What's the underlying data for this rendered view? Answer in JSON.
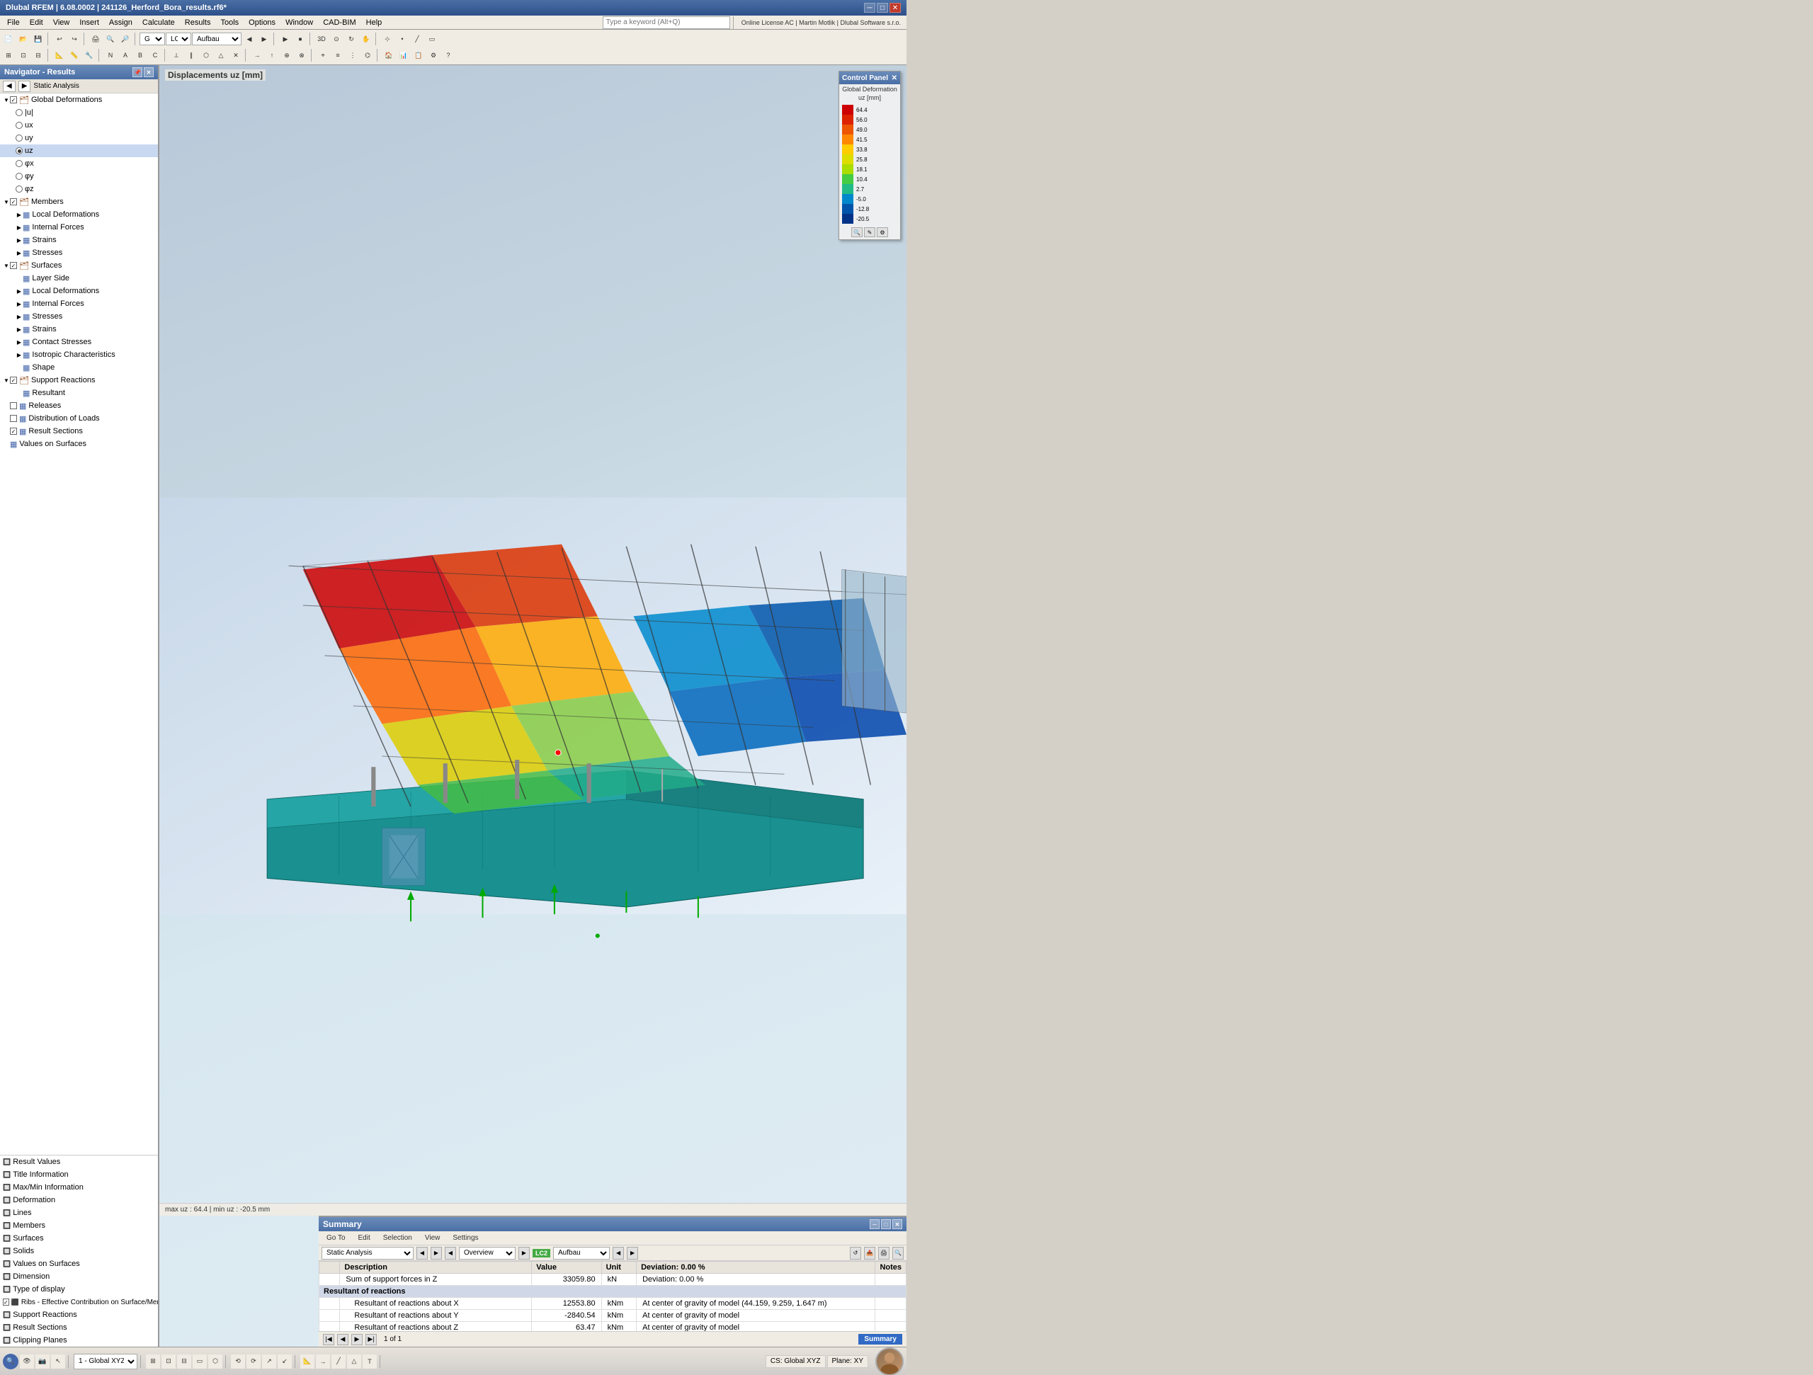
{
  "titleBar": {
    "title": "Dlubal RFEM | 6.08.0002 | 241126_Herford_Bora_results.rf6*",
    "minimize": "─",
    "maximize": "□",
    "close": "✕"
  },
  "menuBar": {
    "items": [
      "File",
      "Edit",
      "View",
      "Insert",
      "Assign",
      "Calculate",
      "Results",
      "Tools",
      "Options",
      "Window",
      "CAD-BIM",
      "Help"
    ]
  },
  "toolbar": {
    "keywordPlaceholder": "Type a keyword (Alt+Q)",
    "licenseInfo": "Online License AC | Martin Motlik | Dlubal Software s.r.o.",
    "lcLabel": "LC2",
    "loadCase": "Aufbau"
  },
  "navigator": {
    "title": "Navigator - Results",
    "dropdown": "Static Analysis",
    "tree": [
      {
        "id": "global-def",
        "label": "Global Deformations",
        "level": 0,
        "type": "checkbox",
        "checked": true,
        "expanded": true,
        "icon": "folder"
      },
      {
        "id": "u",
        "label": "|u|",
        "level": 1,
        "type": "radio",
        "checked": false
      },
      {
        "id": "ux",
        "label": "ux",
        "level": 1,
        "type": "radio",
        "checked": false
      },
      {
        "id": "uy",
        "label": "uy",
        "level": 1,
        "type": "radio",
        "checked": false
      },
      {
        "id": "uz",
        "label": "uz",
        "level": 1,
        "type": "radio",
        "checked": true
      },
      {
        "id": "px",
        "label": "φx",
        "level": 1,
        "type": "radio",
        "checked": false
      },
      {
        "id": "py",
        "label": "φy",
        "level": 1,
        "type": "radio",
        "checked": false
      },
      {
        "id": "pz",
        "label": "φz",
        "level": 1,
        "type": "radio",
        "checked": false
      },
      {
        "id": "members",
        "label": "Members",
        "level": 0,
        "type": "checkbox",
        "checked": true,
        "expanded": true,
        "icon": "folder"
      },
      {
        "id": "local-def",
        "label": "Local Deformations",
        "level": 1,
        "type": "item",
        "expanded": false
      },
      {
        "id": "internal-forces",
        "label": "Internal Forces",
        "level": 1,
        "type": "item",
        "expanded": false
      },
      {
        "id": "strains-m",
        "label": "Strains",
        "level": 1,
        "type": "item",
        "expanded": false
      },
      {
        "id": "stresses-m",
        "label": "Stresses",
        "level": 1,
        "type": "item",
        "expanded": false
      },
      {
        "id": "surfaces",
        "label": "Surfaces",
        "level": 0,
        "type": "checkbox",
        "checked": true,
        "expanded": true,
        "icon": "folder"
      },
      {
        "id": "layer-side",
        "label": "Layer Side",
        "level": 1,
        "type": "item"
      },
      {
        "id": "local-def-s",
        "label": "Local Deformations",
        "level": 1,
        "type": "item"
      },
      {
        "id": "internal-forces-s",
        "label": "Internal Forces",
        "level": 1,
        "type": "item"
      },
      {
        "id": "stresses-s",
        "label": "Stresses",
        "level": 1,
        "type": "item"
      },
      {
        "id": "strains-s",
        "label": "Strains",
        "level": 1,
        "type": "item"
      },
      {
        "id": "contact-stresses",
        "label": "Contact Stresses",
        "level": 1,
        "type": "item"
      },
      {
        "id": "iso-char",
        "label": "Isotropic Characteristics",
        "level": 1,
        "type": "item"
      },
      {
        "id": "shape",
        "label": "Shape",
        "level": 1,
        "type": "item"
      },
      {
        "id": "support-reactions",
        "label": "Support Reactions",
        "level": 0,
        "type": "checkbox",
        "checked": true,
        "expanded": true,
        "icon": "folder"
      },
      {
        "id": "resultant",
        "label": "Resultant",
        "level": 1,
        "type": "item"
      },
      {
        "id": "releases",
        "label": "Releases",
        "level": 0,
        "type": "item"
      },
      {
        "id": "dist-loads",
        "label": "Distribution of Loads",
        "level": 0,
        "type": "item"
      },
      {
        "id": "result-sections",
        "label": "Result Sections",
        "level": 0,
        "type": "checkbox",
        "checked": true
      },
      {
        "id": "values-surfaces",
        "label": "Values on Surfaces",
        "level": 0,
        "type": "item"
      }
    ]
  },
  "navigatorBottom": {
    "items": [
      {
        "id": "result-values",
        "label": "Result Values"
      },
      {
        "id": "title-info",
        "label": "Title Information"
      },
      {
        "id": "max-min-info",
        "label": "Max/Min Information"
      },
      {
        "id": "deformation",
        "label": "Deformation"
      },
      {
        "id": "lines",
        "label": "Lines"
      },
      {
        "id": "members-b",
        "label": "Members"
      },
      {
        "id": "surfaces-b",
        "label": "Surfaces"
      },
      {
        "id": "solids",
        "label": "Solids"
      },
      {
        "id": "values-surfaces-b",
        "label": "Values on Surfaces"
      },
      {
        "id": "dimension",
        "label": "Dimension"
      },
      {
        "id": "type-display",
        "label": "Type of display"
      },
      {
        "id": "ribs",
        "label": "Ribs - Effective Contribution on Surface/Member"
      },
      {
        "id": "support-reactions-b",
        "label": "Support Reactions"
      },
      {
        "id": "result-sections-b",
        "label": "Result Sections"
      },
      {
        "id": "clipping-planes",
        "label": "Clipping Planes"
      }
    ]
  },
  "viewport": {
    "label": "Displacements uz [mm]",
    "infoText": "max uz : 64.4 | min uz : -20.5 mm"
  },
  "colorPanel": {
    "title": "Control Panel",
    "subtitle": "Global Deformation\nuz [mm]",
    "values": [
      "64.4",
      "56.0",
      "49.0",
      "41.5",
      "33.8",
      "25.8",
      "18.1",
      "10.4",
      "2.7",
      "-5.0",
      "-12.8",
      "-20.5"
    ],
    "colors": [
      "#cc0000",
      "#dd2200",
      "#ee4400",
      "#ff6600",
      "#ffaa00",
      "#ffdd00",
      "#aadd00",
      "#55cc44",
      "#00aa88",
      "#0077cc",
      "#0044aa",
      "#002288"
    ]
  },
  "summary": {
    "title": "Summary",
    "toolbar": [
      "Go To",
      "Edit",
      "Selection",
      "View",
      "Settings"
    ],
    "analysisType": "Static Analysis",
    "overviewLabel": "Overview",
    "lcBadge": "LC2",
    "lcName": "Aufbau",
    "tableHeaders": [
      "",
      "Description",
      "Value",
      "Unit",
      "Deviation: 0.00 %",
      "Notes"
    ],
    "rows": [
      {
        "type": "data",
        "desc": "Sum of support forces in Z",
        "value": "33059.80",
        "unit": "kN",
        "deviation": "Deviation: 0.00 %",
        "notes": ""
      },
      {
        "type": "group",
        "desc": "Resultant of reactions",
        "value": "",
        "unit": "",
        "deviation": "",
        "notes": ""
      },
      {
        "type": "data",
        "desc": "Resultant of reactions about X",
        "value": "12553.80",
        "unit": "kNm",
        "deviation": "At center of gravity of model (44.159, 9.259, 1.647 m)",
        "notes": ""
      },
      {
        "type": "data",
        "desc": "Resultant of reactions about Y",
        "value": "-2840.54",
        "unit": "kNm",
        "deviation": "At center of gravity of model",
        "notes": ""
      },
      {
        "type": "data",
        "desc": "Resultant of reactions about Z",
        "value": "63.47",
        "unit": "kNm",
        "deviation": "At center of gravity of model",
        "notes": ""
      }
    ],
    "pageInfo": "1 of 1",
    "tabLabel": "Summary"
  },
  "statusBar": {
    "viewNum": "1",
    "viewLabel": "Global XYZ",
    "csLabel": "CS: Global XYZ",
    "planeLabel": "Plane: XY"
  }
}
